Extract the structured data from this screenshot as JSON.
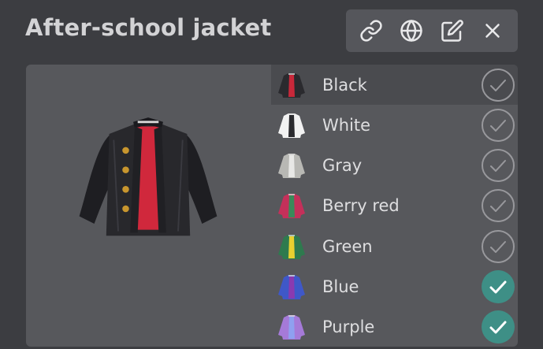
{
  "page": {
    "title": "After-school jacket"
  },
  "toolbar": {
    "buttons": [
      {
        "name": "link-button",
        "icon": "link-icon"
      },
      {
        "name": "globe-button",
        "icon": "globe-icon"
      },
      {
        "name": "edit-button",
        "icon": "edit-icon"
      },
      {
        "name": "close-button",
        "icon": "close-icon"
      }
    ]
  },
  "variants": [
    {
      "label": "Black",
      "body": "#2a2a2e",
      "inner": "#c8283a",
      "checked": false,
      "selected": true
    },
    {
      "label": "White",
      "body": "#f2f2f2",
      "inner": "#2a2a2e",
      "checked": false,
      "selected": false
    },
    {
      "label": "Gray",
      "body": "#b8b8b4",
      "inner": "#e8e8e6",
      "checked": false,
      "selected": false
    },
    {
      "label": "Berry red",
      "body": "#c4305a",
      "inner": "#3a8a5a",
      "checked": false,
      "selected": false
    },
    {
      "label": "Green",
      "body": "#2e7a4e",
      "inner": "#e8d030",
      "checked": false,
      "selected": false
    },
    {
      "label": "Blue",
      "body": "#3f58c8",
      "inner": "#8a3ab0",
      "checked": true,
      "selected": false
    },
    {
      "label": "Purple",
      "body": "#a57ad8",
      "inner": "#8fa0f0",
      "checked": true,
      "selected": false
    }
  ],
  "colors": {
    "check_on": "#3e8f86",
    "check_off": "#98989c"
  }
}
